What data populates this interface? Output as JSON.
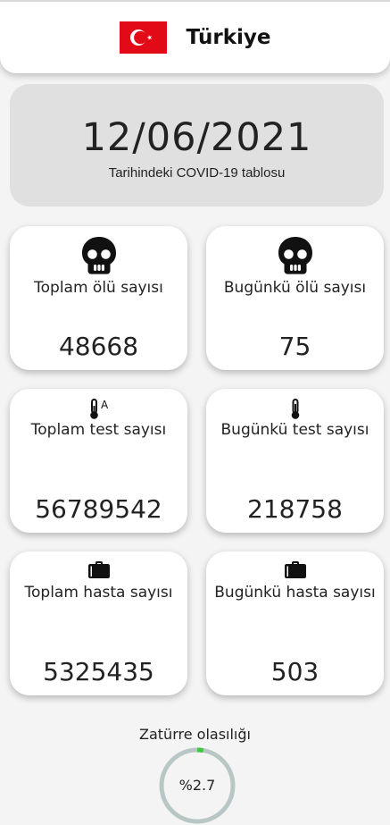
{
  "header": {
    "country": "Türkiye",
    "flag_colors": {
      "background": "#e30a17",
      "symbol": "#ffffff"
    }
  },
  "date_card": {
    "date": "12/06/2021",
    "subtitle": "Tarihindeki COVID-19 tablosu"
  },
  "stats": {
    "total_deaths": {
      "label": "Toplam ölü sayısı",
      "value": "48668",
      "icon": "skull-icon"
    },
    "today_deaths": {
      "label": "Bugünkü ölü sayısı",
      "value": "75",
      "icon": "skull-icon"
    },
    "total_tests": {
      "label": "Toplam test sayısı",
      "value": "56789542",
      "icon": "thermometer-a-icon"
    },
    "today_tests": {
      "label": "Bugünkü test sayısı",
      "value": "218758",
      "icon": "thermometer-icon"
    },
    "total_patients": {
      "label": "Toplam hasta sayısı",
      "value": "5325435",
      "icon": "briefcase-icon"
    },
    "today_patients": {
      "label": "Bugünkü hasta sayısı",
      "value": "503",
      "icon": "briefcase-icon"
    }
  },
  "pneumonia": {
    "label": "Zatürre olasılığı",
    "value_text": "%2.7",
    "fraction": 0.027,
    "colors": {
      "track": "#b8c7c6",
      "progress": "#3cc93c"
    }
  }
}
